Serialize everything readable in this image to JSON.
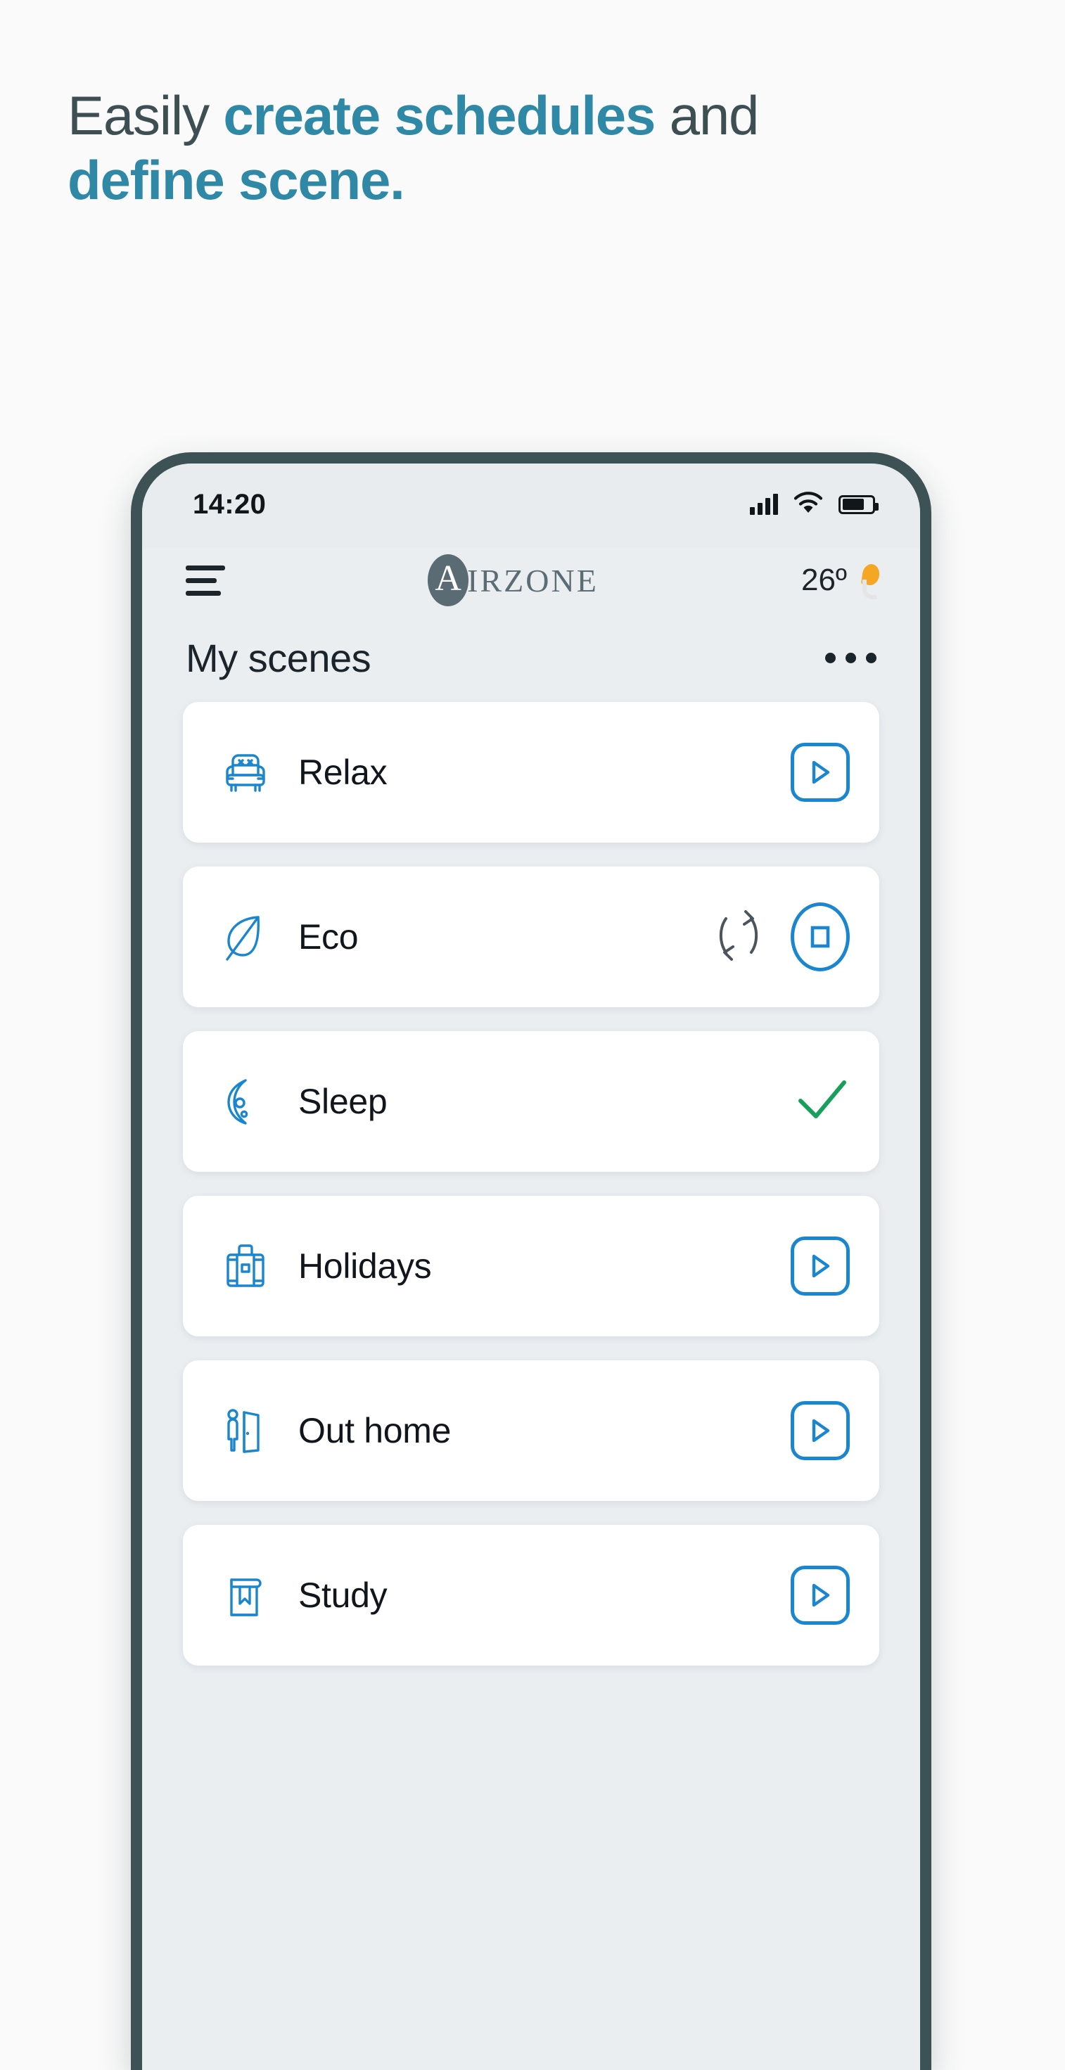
{
  "headline": {
    "line1_plain_a": "Easily ",
    "line1_strong": "create schedules",
    "line1_plain_b": " and",
    "line2_strong": "define scene."
  },
  "colors": {
    "accent_teal": "#2E88A6",
    "heading_dark": "#3D4F52",
    "icon_blue": "#1B86D0",
    "check_green": "#17A05A",
    "phone_frame": "#3D5254",
    "screen_bg": "#E9EDF0",
    "weather_orange": "#F5A623"
  },
  "phone": {
    "statusbar": {
      "time": "14:20",
      "icons": [
        "signal-icon",
        "wifi-icon",
        "battery-icon"
      ],
      "battery_level": "75"
    },
    "appbar": {
      "menu_icon": "hamburger-menu-icon",
      "brand_initial": "A",
      "brand_text": "IRZONE",
      "temperature": "26º",
      "weather_icon": "sun-behind-cloud-icon"
    },
    "section": {
      "title": "My scenes",
      "overflow_icon": "more-options-icon"
    },
    "scenes": [
      {
        "label": "Relax",
        "icon": "armchair-icon",
        "action": "play",
        "running": false
      },
      {
        "label": "Eco",
        "icon": "leaf-icon",
        "action": "stop",
        "running": true
      },
      {
        "label": "Sleep",
        "icon": "moon-icon",
        "action": "check",
        "running": false
      },
      {
        "label": "Holidays",
        "icon": "suitcase-icon",
        "action": "play",
        "running": false
      },
      {
        "label": "Out home",
        "icon": "person-door-icon",
        "action": "play",
        "running": false
      },
      {
        "label": "Study",
        "icon": "book-icon",
        "action": "play",
        "running": false
      }
    ]
  }
}
